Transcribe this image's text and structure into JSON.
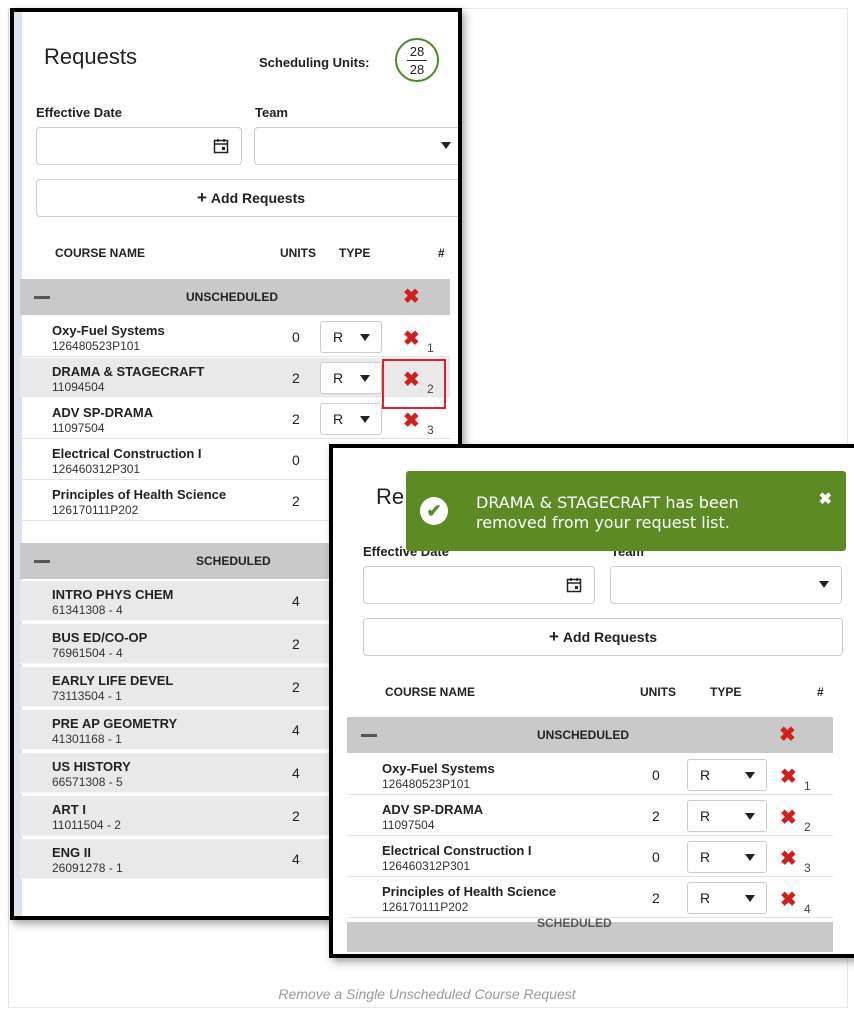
{
  "caption": "Remove a Single Unscheduled Course Request",
  "panel": {
    "title": "Requests",
    "scheduling_units_label": "Scheduling Units:",
    "units_used": "28",
    "units_total": "28",
    "effective_date_label": "Effective Date",
    "team_label": "Team",
    "add_requests_label": "Add Requests",
    "columns": {
      "course_name": "COURSE NAME",
      "units": "UNITS",
      "type": "TYPE",
      "number": "#"
    },
    "unscheduled_label": "UNSCHEDULED",
    "scheduled_label": "SCHEDULED"
  },
  "before": {
    "unscheduled": [
      {
        "name": "Oxy-Fuel Systems",
        "id": "126480523P101",
        "units": "0",
        "type": "R",
        "num": "1"
      },
      {
        "name": "DRAMA & STAGECRAFT",
        "id": "11094504",
        "units": "2",
        "type": "R",
        "num": "2"
      },
      {
        "name": "ADV SP-DRAMA",
        "id": "11097504",
        "units": "2",
        "type": "R",
        "num": "3"
      },
      {
        "name": "Electrical Construction I",
        "id": "126460312P301",
        "units": "0"
      },
      {
        "name": "Principles of Health Science",
        "id": "126170111P202",
        "units": "2"
      }
    ],
    "scheduled": [
      {
        "name": "INTRO PHYS CHEM",
        "id": "61341308 - 4",
        "units": "4"
      },
      {
        "name": "BUS ED/CO-OP",
        "id": "76961504 - 4",
        "units": "2"
      },
      {
        "name": "EARLY LIFE DEVEL",
        "id": "73113504 - 1",
        "units": "2"
      },
      {
        "name": "PRE AP GEOMETRY",
        "id": "41301168 - 1",
        "units": "4"
      },
      {
        "name": "US HISTORY",
        "id": "66571308 - 5",
        "units": "4"
      },
      {
        "name": "ART I",
        "id": "11011504 - 2",
        "units": "2"
      },
      {
        "name": "ENG II",
        "id": "26091278 - 1",
        "units": "4"
      }
    ]
  },
  "after": {
    "title_partial": "Re",
    "effective_date_partial": "Effective Date",
    "team_partial": "Team",
    "toast": {
      "line1": "DRAMA & STAGECRAFT has been",
      "line2": "removed from your request list."
    },
    "unscheduled": [
      {
        "name": "Oxy-Fuel Systems",
        "id": "126480523P101",
        "units": "0",
        "type": "R",
        "num": "1"
      },
      {
        "name": "ADV SP-DRAMA",
        "id": "11097504",
        "units": "2",
        "type": "R",
        "num": "2"
      },
      {
        "name": "Electrical Construction I",
        "id": "126460312P301",
        "units": "0",
        "type": "R",
        "num": "3"
      },
      {
        "name": "Principles of Health Science",
        "id": "126170111P202",
        "units": "2",
        "type": "R",
        "num": "4"
      }
    ],
    "next_group_partial": "SCHEDULED"
  },
  "colors": {
    "remove": "#d0201e",
    "toast": "#5e8a26",
    "highlight": "#e0202a",
    "group_row": "#c9c9c9"
  }
}
